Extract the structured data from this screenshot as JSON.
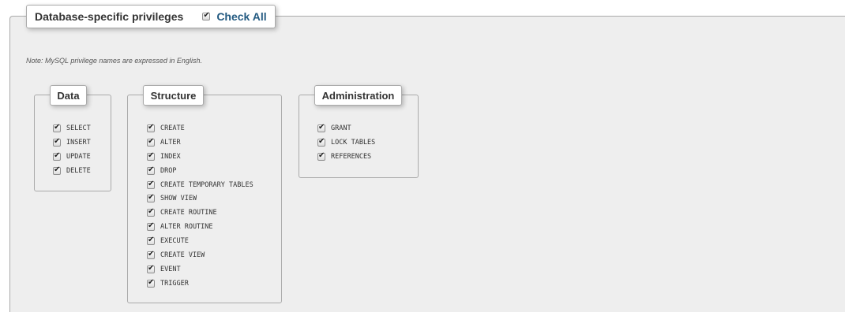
{
  "header": {
    "title": "Database-specific privileges",
    "check_all_label": "Check All"
  },
  "note": "Note: MySQL privilege names are expressed in English.",
  "groups": {
    "data": {
      "title": "Data",
      "items": [
        "SELECT",
        "INSERT",
        "UPDATE",
        "DELETE"
      ]
    },
    "structure": {
      "title": "Structure",
      "items": [
        "CREATE",
        "ALTER",
        "INDEX",
        "DROP",
        "CREATE TEMPORARY TABLES",
        "SHOW VIEW",
        "CREATE ROUTINE",
        "ALTER ROUTINE",
        "EXECUTE",
        "CREATE VIEW",
        "EVENT",
        "TRIGGER"
      ]
    },
    "administration": {
      "title": "Administration",
      "items": [
        "GRANT",
        "LOCK TABLES",
        "REFERENCES"
      ]
    }
  },
  "all_checked": true,
  "colors": {
    "panel_bg": "#eeeeee",
    "border": "#aaaaaa",
    "link": "#235a81"
  }
}
